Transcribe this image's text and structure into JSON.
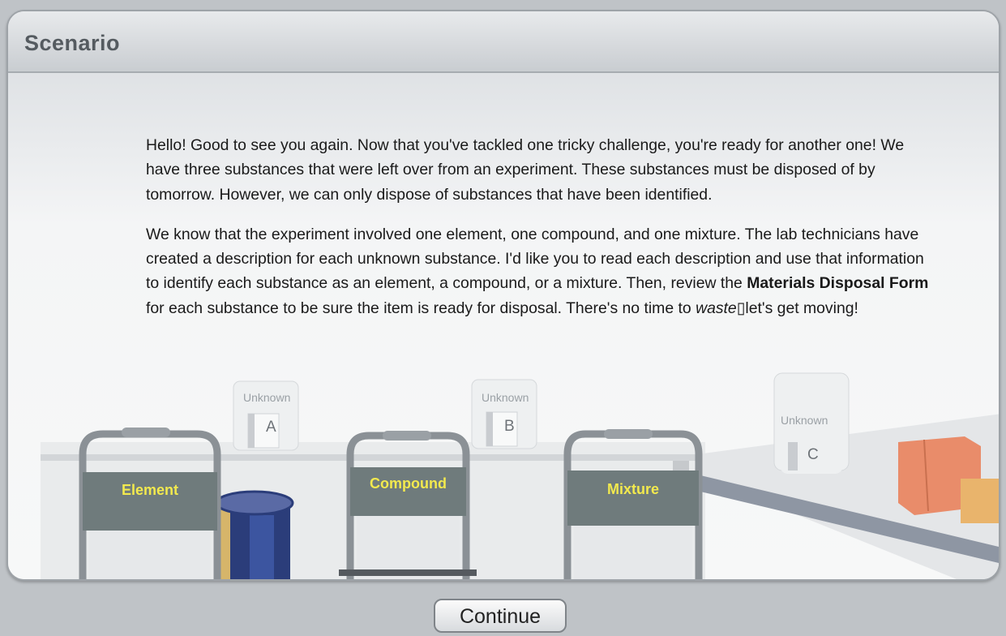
{
  "window": {
    "title": "Scenario"
  },
  "body": {
    "p1": "Hello! Good to see you again. Now that you've tackled one tricky challenge, you're ready for another one! We have three substances that were left over from an experiment. These substances must be disposed of by tomorrow. However, we can only dispose of substances that have been identified.",
    "p2_before": "We know that the experiment involved one element, one compound, and one mixture. The lab technicians have created a description for each unknown substance. I'd like you to read each description and use that information to identify each substance as an element, a compound, or a mixture. Then, review the ",
    "p2_bold": "Materials Disposal Form",
    "p2_mid": " for each substance to be sure the item is ready for disposal. There's no time to ",
    "p2_italic": "waste",
    "p2_after": "let's get moving!"
  },
  "scene": {
    "carts": [
      {
        "label": "Element"
      },
      {
        "label": "Compound"
      },
      {
        "label": "Mixture"
      }
    ],
    "jars": [
      {
        "tag": "Unknown",
        "letter": "A"
      },
      {
        "tag": "Unknown",
        "letter": "B"
      },
      {
        "tag": "Unknown",
        "letter": "C"
      }
    ]
  },
  "footer": {
    "continue_label": "Continue"
  },
  "colors": {
    "cart_label": "#f2e94e",
    "cart_panel": "#6f7b7c"
  }
}
